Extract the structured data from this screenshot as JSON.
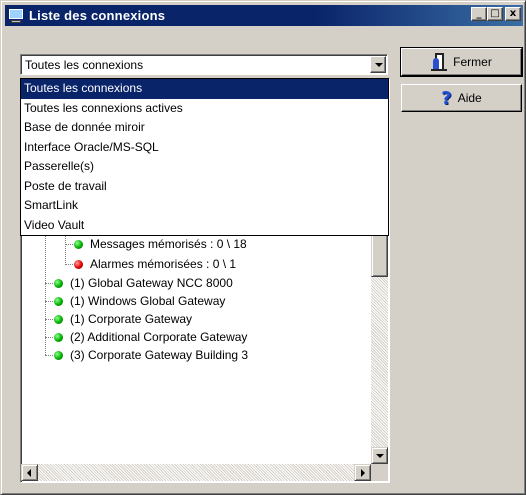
{
  "window": {
    "title": "Liste des connexions",
    "controls": {
      "minimize": "_",
      "maximize": "□",
      "close": "x"
    },
    "icon": "monitor-icon"
  },
  "filter": {
    "selected": "Toutes les connexions",
    "options": [
      "Toutes les connexions",
      "Toutes les connexions actives",
      "Base de donnée miroir",
      "Interface Oracle/MS-SQL",
      "Passerelle(s)",
      "Poste de travail",
      "SmartLink",
      "Video Vault"
    ]
  },
  "tree": {
    "items": [
      {
        "label": "Messages mémorisés : 0 \\ 18",
        "status": "green",
        "level": 2
      },
      {
        "label": "Alarmes mémorisées : 0 \\ 1",
        "status": "red",
        "level": 2
      },
      {
        "label": "(1) Global Gateway NCC 8000",
        "status": "green",
        "level": 1
      },
      {
        "label": "(1) Windows Global Gateway",
        "status": "green",
        "level": 1
      },
      {
        "label": "(1) Corporate Gateway",
        "status": "green",
        "level": 1
      },
      {
        "label": "(2) Additional Corporate Gateway",
        "status": "green",
        "level": 1
      },
      {
        "label": "(3) Corporate Gateway Building 3",
        "status": "green",
        "level": 1
      }
    ]
  },
  "buttons": {
    "close_label": "Fermer",
    "help_label": "Aide",
    "close_icon": "exit-door-icon",
    "help_icon": "question-mark-icon"
  },
  "colors": {
    "titlebar": "#0a246a",
    "selection": "#0a246a",
    "status_ok": "#00b000",
    "status_alarm": "#e00000",
    "face": "#d4d0c8"
  }
}
